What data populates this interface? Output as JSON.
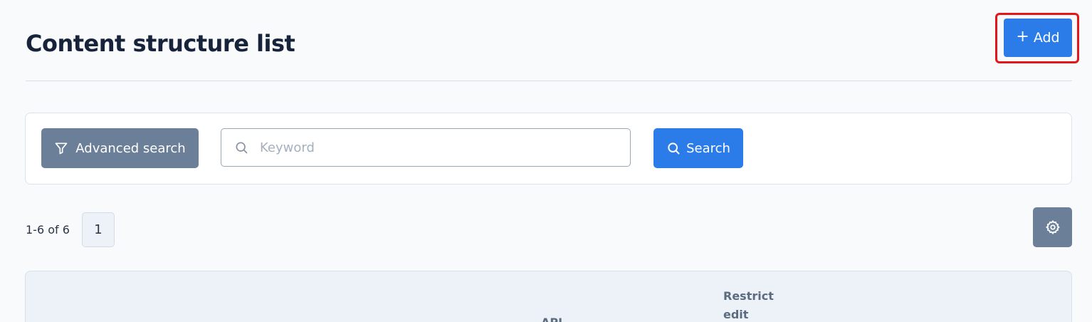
{
  "header": {
    "title": "Content structure list",
    "add_label": "Add"
  },
  "search": {
    "advanced_label": "Advanced search",
    "keyword_placeholder": "Keyword",
    "keyword_value": "",
    "search_label": "Search"
  },
  "pagination": {
    "range": "1-6 of 6",
    "current_page": "1"
  },
  "table": {
    "columns": [
      "API",
      "Restrict edit"
    ]
  },
  "colors": {
    "primary": "#2b7ce9",
    "secondary": "#6b7f98",
    "highlight": "#e5161b"
  },
  "icons": {
    "add": "plus-icon",
    "advanced": "filter-icon",
    "keyword": "search-icon",
    "search": "search-icon",
    "settings": "gear-icon"
  }
}
